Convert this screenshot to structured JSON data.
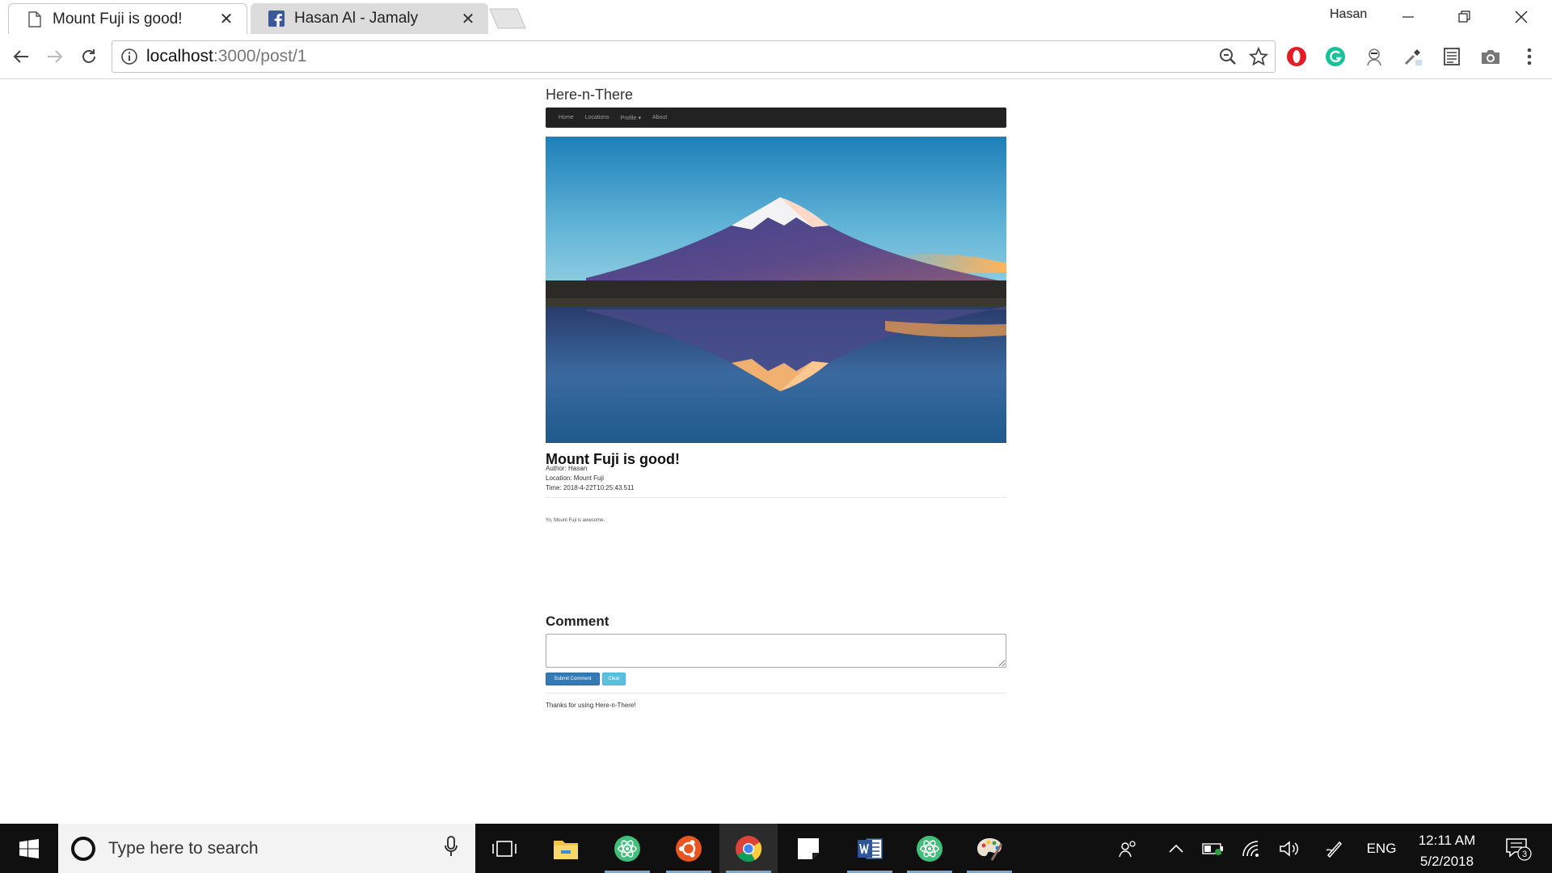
{
  "browser": {
    "tabs": [
      {
        "title": "Mount Fuji is good!",
        "icon": "page-icon",
        "active": true
      },
      {
        "title": "Hasan Al - Jamaly",
        "icon": "facebook-icon",
        "active": false
      }
    ],
    "profile_name": "Hasan",
    "url_host": "localhost",
    "url_path": ":3000/post/1"
  },
  "site": {
    "brand": "Here-n-There",
    "nav": [
      "Home",
      "Locations",
      "Profile ▾",
      "About"
    ]
  },
  "post": {
    "title": "Mount Fuji is good!",
    "author": "Author: Hasan",
    "location": "Location: Mount Fuji",
    "time": "Time: 2018-4-22T10:25:43.511",
    "body": "Yo, Mount Fuji is awesome."
  },
  "comment": {
    "heading": "Comment",
    "value": "",
    "submit_label": "Submit Comment",
    "clear_label": "Clear"
  },
  "footer": {
    "text": "Thanks for using Here-n-There!"
  },
  "taskbar": {
    "search_placeholder": "Type here to search",
    "language": "ENG",
    "time": "12:11 AM",
    "date": "5/2/2018",
    "notification_count": "3"
  },
  "colors": {
    "navbar_bg": "#222222",
    "primary_button": "#337ab7",
    "info_button": "#5bc0de",
    "taskbar_bg": "#101010"
  }
}
